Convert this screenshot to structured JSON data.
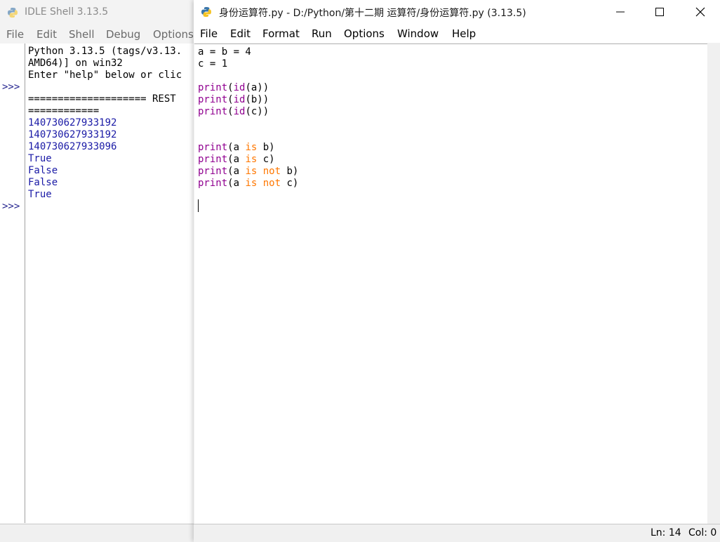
{
  "shell_window": {
    "title": "IDLE Shell 3.13.5",
    "menu": [
      "File",
      "Edit",
      "Shell",
      "Debug",
      "Options"
    ],
    "prompts": [
      ">>>",
      ">>>"
    ],
    "lines": [
      "Python 3.13.5 (tags/v3.13.",
      "AMD64)] on win32",
      "Enter \"help\" below or clic",
      "",
      "==================== REST",
      "============",
      "140730627933192",
      "140730627933192",
      "140730627933096",
      "True",
      "False",
      "False",
      "True"
    ]
  },
  "editor_window": {
    "title": "身份运算符.py - D:/Python/第十二期 运算符/身份运算符.py (3.13.5)",
    "menu": [
      "File",
      "Edit",
      "Format",
      "Run",
      "Options",
      "Window",
      "Help"
    ],
    "code": {
      "line1": "a = b = 4",
      "line2": "c = 1",
      "print": "print",
      "id": "id",
      "is": "is",
      "not": "not",
      "id_args": [
        "(a))",
        "(b))",
        "(c))"
      ],
      "open_paren": "(",
      "stmt_a": "(a ",
      "var_b": " b)",
      "var_c": " c)"
    },
    "status": {
      "ln": "Ln: 14",
      "col": "Col: 0"
    },
    "icons": {
      "minimize": "minimize-icon",
      "maximize": "maximize-icon",
      "close": "close-icon"
    }
  },
  "colors": {
    "builtin": "#900090",
    "keyword": "#ff7700",
    "output": "#1a1aa6"
  }
}
